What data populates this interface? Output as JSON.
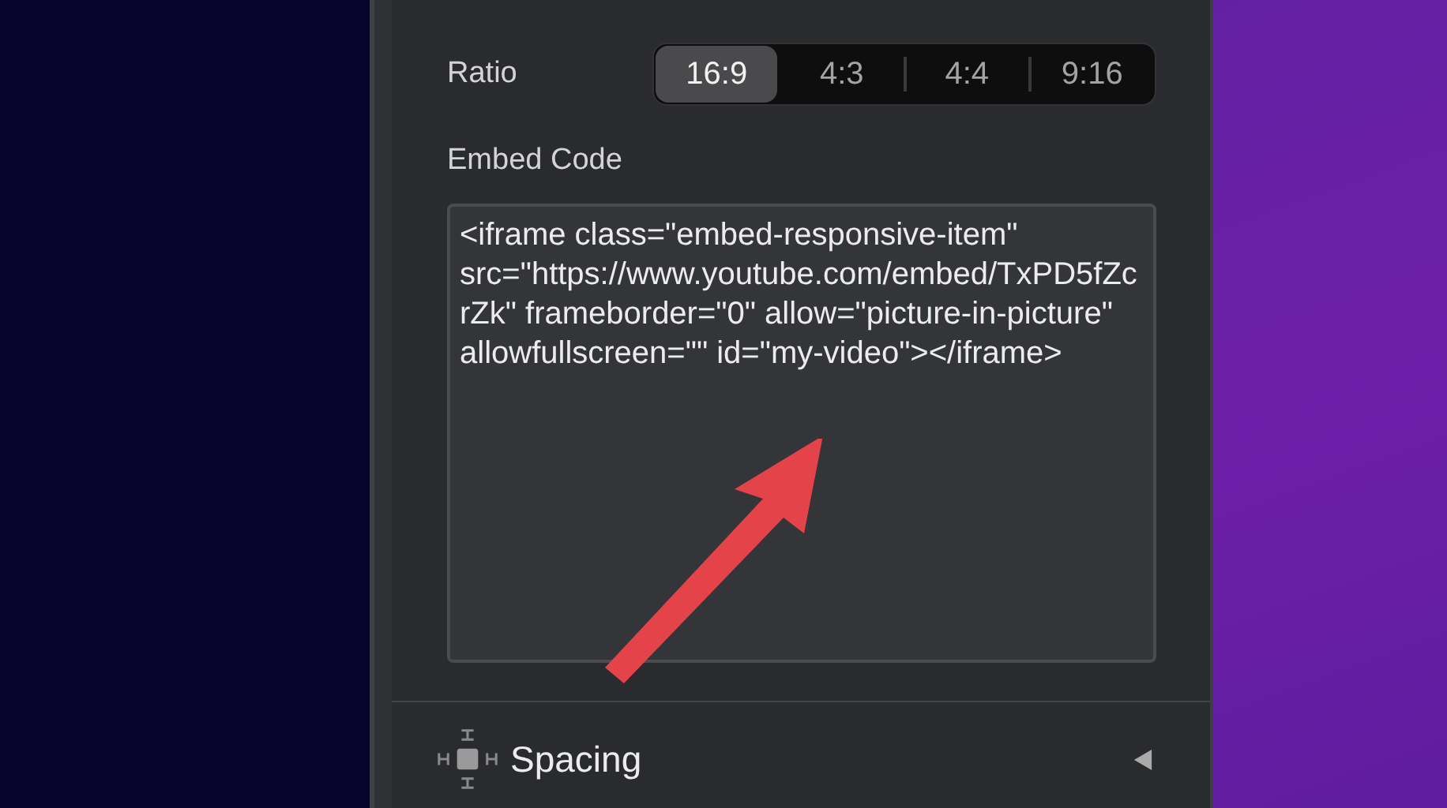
{
  "ratio": {
    "label": "Ratio",
    "options": [
      {
        "label": "16:9",
        "selected": true
      },
      {
        "label": "4:3",
        "selected": false
      },
      {
        "label": "4:4",
        "selected": false
      },
      {
        "label": "9:16",
        "selected": false
      }
    ]
  },
  "embed_code": {
    "label": "Embed Code",
    "value": "<iframe class=\"embed-responsive-item\" src=\"https://www.youtube.com/embed/TxPD5fZcrZk\" frameborder=\"0\" allow=\"picture-in-picture\" allowfullscreen=\"\" id=\"my-video\"></iframe>"
  },
  "spacing": {
    "label": "Spacing",
    "expanded": false
  }
}
